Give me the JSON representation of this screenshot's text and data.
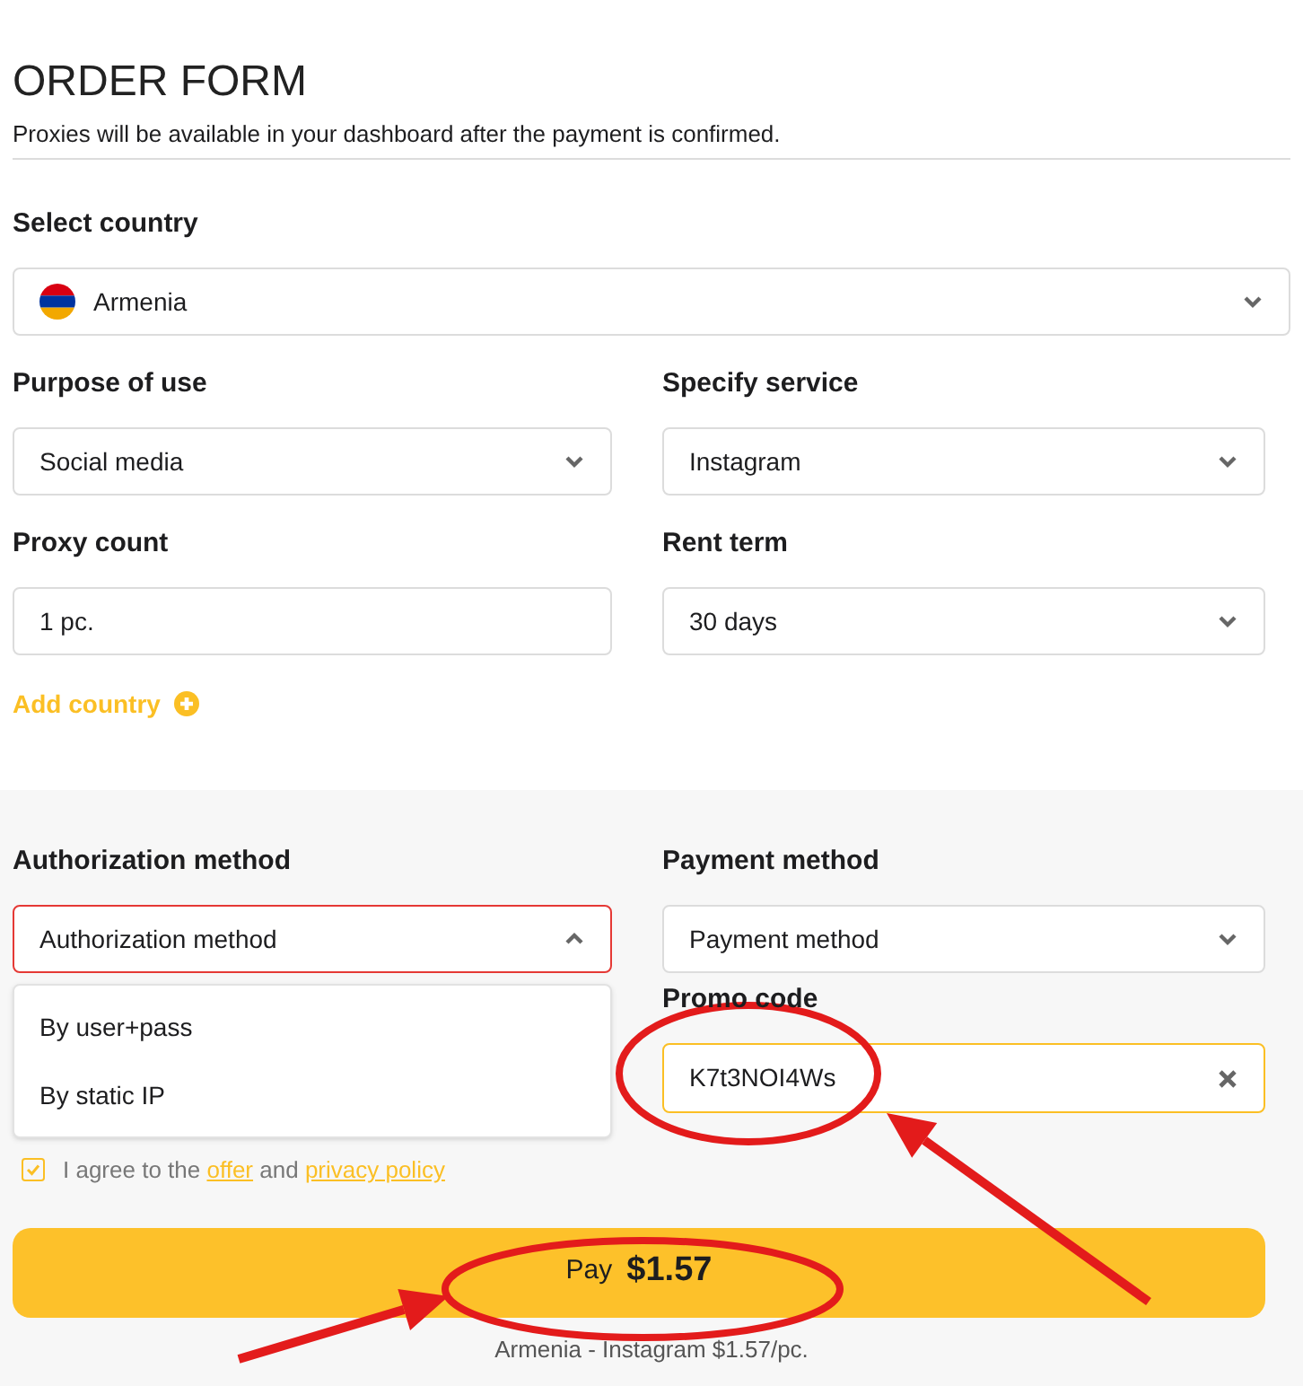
{
  "title": "ORDER FORM",
  "subtitle": "Proxies will be available in your dashboard after the payment is confirmed.",
  "country": {
    "label": "Select country",
    "value": "Armenia"
  },
  "fields": [
    {
      "kind": "select",
      "label": "Purpose of use",
      "value": "Social media"
    },
    {
      "kind": "select",
      "label": "Specify service",
      "value": "Instagram"
    },
    {
      "kind": "input",
      "label": "Proxy count",
      "value": "1 pc."
    },
    {
      "kind": "select",
      "label": "Rent term",
      "value": "30 days"
    }
  ],
  "add_country": "Add country",
  "auth": {
    "label": "Authorization method",
    "value": "Authorization method",
    "expanded": true,
    "options": [
      "By user+pass",
      "By static IP"
    ]
  },
  "payment": {
    "label": "Payment method",
    "value": "Payment method",
    "expanded": false
  },
  "promo": {
    "label": "Promo code",
    "value": "K7t3NOI4Ws"
  },
  "agreement": {
    "checked": true,
    "prefix": "I agree to the",
    "link_1": "offer",
    "middle": "and",
    "link_2": "privacy policy"
  },
  "pay": {
    "label": "Pay",
    "amount": "$1.57"
  },
  "summary": "Armenia - Instagram $1.57/pc.",
  "annotations": [
    {
      "kind": "ellipse"
    },
    {
      "kind": "arrow"
    },
    {
      "kind": "ellipse"
    },
    {
      "kind": "arrow"
    }
  ]
}
